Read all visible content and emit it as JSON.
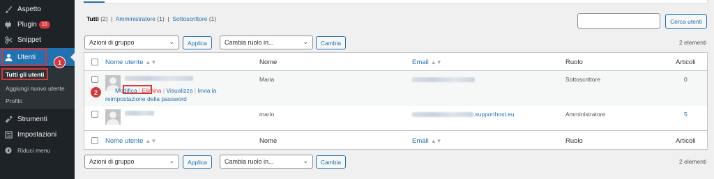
{
  "sidebar": {
    "items": [
      {
        "label": "Aspetto",
        "icon": "paintbrush-icon"
      },
      {
        "label": "Plugin",
        "icon": "plug-icon",
        "badge": "10"
      },
      {
        "label": "Snippet",
        "icon": "scissors-icon"
      },
      {
        "label": "Utenti",
        "icon": "user-icon"
      },
      {
        "label": "Strumenti",
        "icon": "wrench-icon"
      },
      {
        "label": "Impostazioni",
        "icon": "settings-icon"
      },
      {
        "label": "Riduci menu",
        "icon": "collapse-icon"
      }
    ],
    "submenu": [
      "Tutti gli utenti",
      "Aggiungi nuovo utente",
      "Profilo"
    ]
  },
  "annotations": {
    "step1": "1",
    "step2": "2"
  },
  "views": {
    "all_label": "Tutti",
    "all_count": "(2)",
    "admin_label": "Amministratore",
    "admin_count": "(1)",
    "sub_label": "Sottoscrittore",
    "sub_count": "(1)"
  },
  "search": {
    "value": "",
    "button": "Cerca utenti"
  },
  "bulk": {
    "actions_selected": "Azioni di gruppo",
    "apply": "Applica",
    "role_selected": "Cambia ruolo in...",
    "change": "Cambia",
    "count": "2 elementi"
  },
  "table": {
    "headers": {
      "username": "Nome utente",
      "name": "Nome",
      "email": "Email",
      "role": "Ruolo",
      "posts": "Articoli"
    },
    "rows": [
      {
        "name": "Maria",
        "email_suffix": "",
        "role": "Sottoscrittore",
        "posts": "0"
      },
      {
        "name": "mario",
        "email_suffix": ".supporthost.eu",
        "role": "Amministratore",
        "posts": "5"
      }
    ],
    "row_actions": {
      "edit": "Modifica",
      "delete": "Elimina",
      "view": "Visualizza",
      "reset": "Invia la",
      "reset2": "reimpostazione della password"
    }
  },
  "colors": {
    "accent": "#2271b1",
    "sidebar": "#1d2327",
    "danger": "#d63638"
  }
}
